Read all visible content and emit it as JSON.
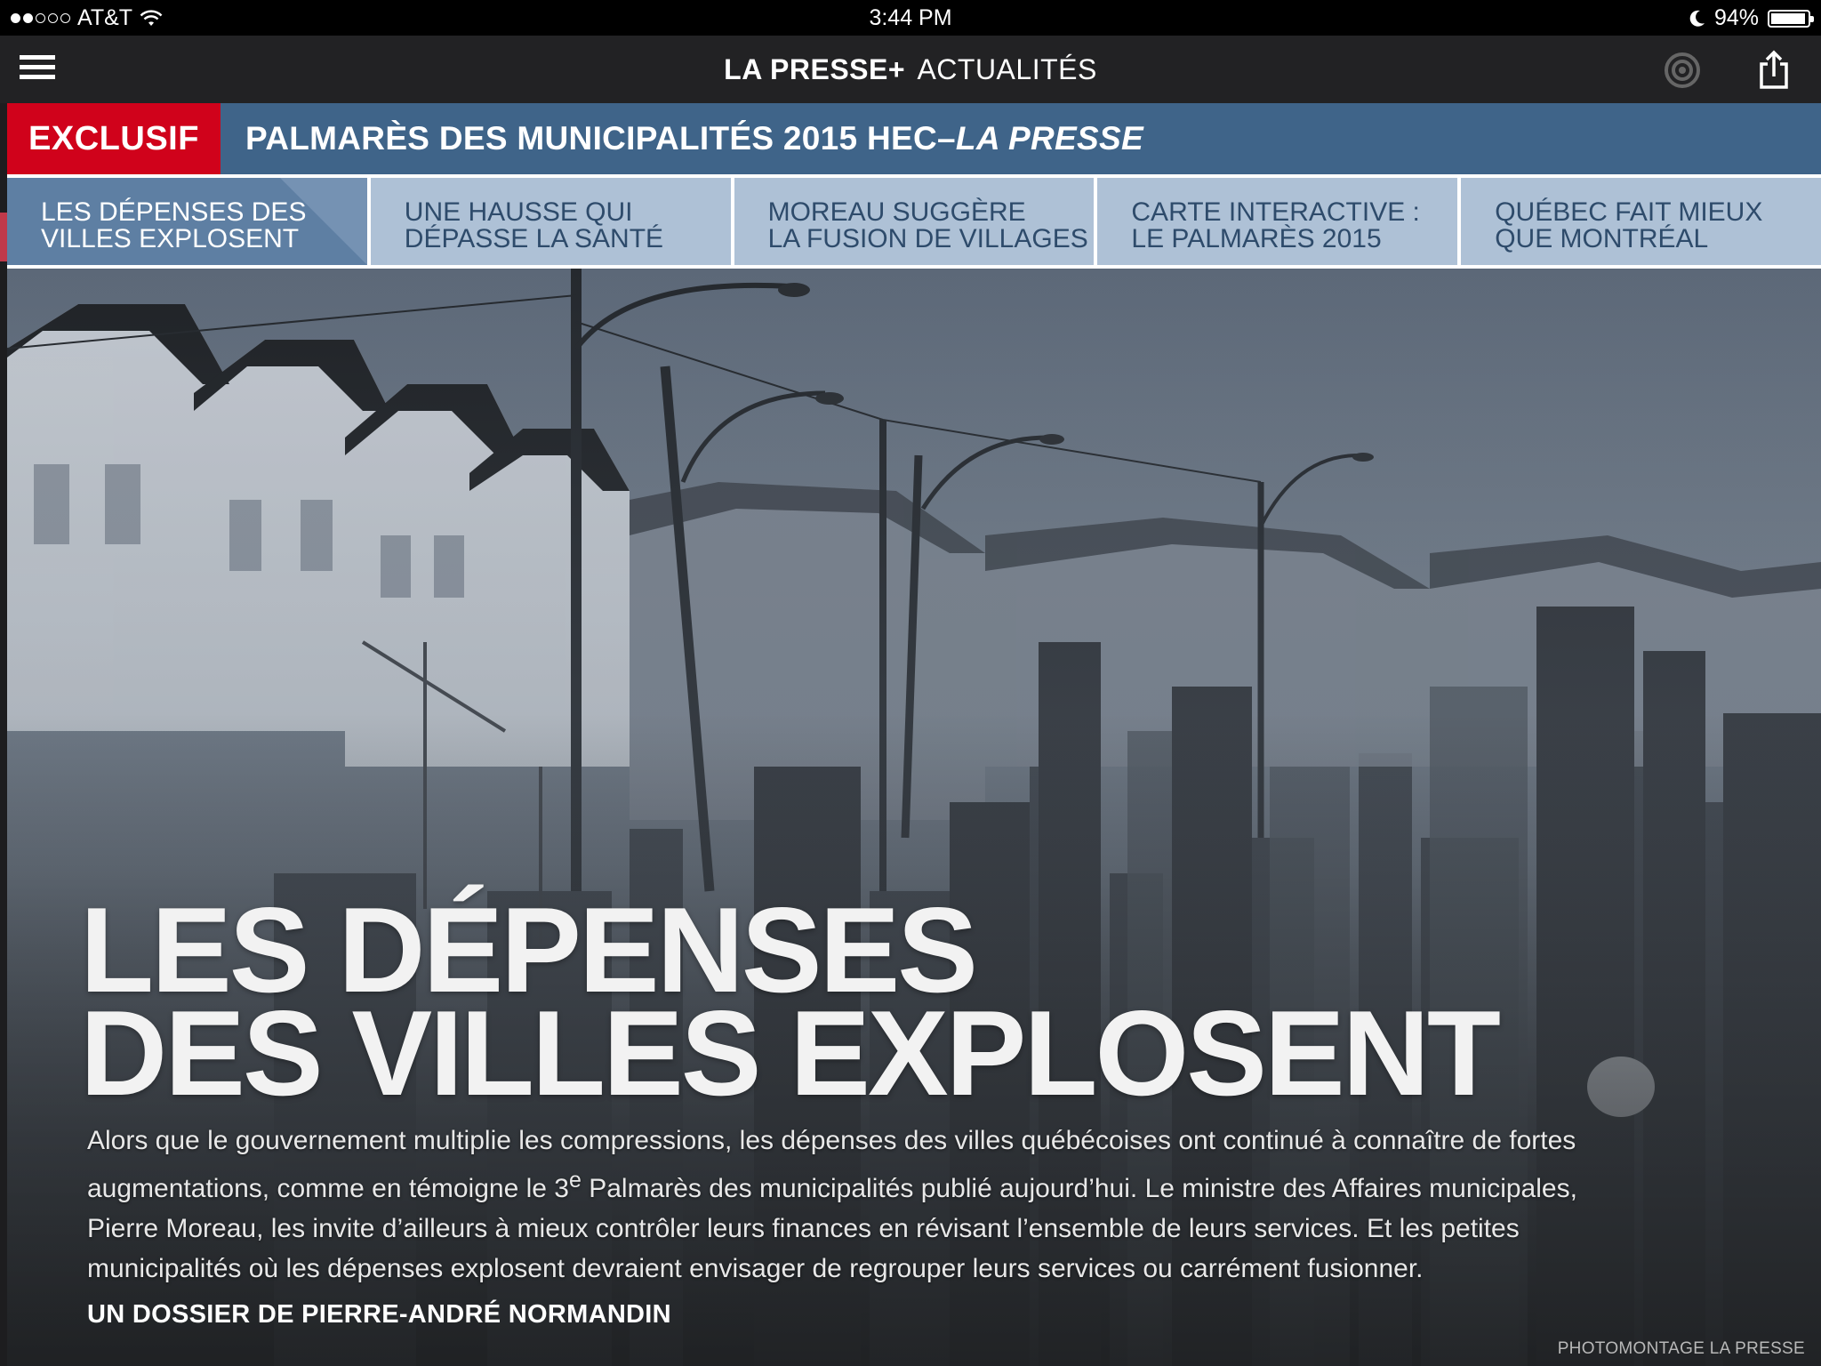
{
  "status_bar": {
    "carrier": "AT&T",
    "time": "3:44 PM",
    "battery": "94%",
    "battery_level": 0.94,
    "signal_bars_filled": 2,
    "signal_bars_total": 5
  },
  "app_bar": {
    "brand": "LA PRESSE+",
    "section": "ACTUALITÉS"
  },
  "banner": {
    "tag": "EXCLUSIF",
    "title_main": "PALMARÈS DES MUNICIPALITÉS 2015 HEC–",
    "title_italic": "LA PRESSE"
  },
  "tabs": [
    {
      "line1": "Les dépenses des",
      "line2": "villes explosent",
      "active": true
    },
    {
      "line1": "Une hausse qui",
      "line2": "dépasse la santé",
      "active": false
    },
    {
      "line1": "Moreau suggère",
      "line2": "la fusion de villages",
      "active": false
    },
    {
      "line1": "Carte interactive :",
      "line2": "le palmarès 2015",
      "active": false
    },
    {
      "line1": "Québec fait mieux",
      "line2": "que Montréal",
      "active": false
    }
  ],
  "article": {
    "headline_line1": "Les dépenses",
    "headline_line2": "des villes explosent",
    "dek_before_sup": "Alors que le gouvernement multiplie les compressions, les dépenses des villes québécoises ont continué à connaître de fortes augmentations, comme en témoigne le 3",
    "dek_sup": "e",
    "dek_after_sup": " Palmarès des municipalités publié aujourd’hui. Le ministre des Affaires municipales, Pierre Moreau, les invite d’ailleurs à mieux contrôler leurs finances en révisant l’ensemble de leurs services. Et les petites municipalités où les dépenses explosent devraient envisager de regrouper leurs services ou carrément fusionner.",
    "byline": "UN DOSSIER DE PIERRE-ANDRÉ NORMANDIN",
    "photo_credit": "PHOTOMONTAGE LA PRESSE"
  },
  "icons": {
    "menu": "hamburger-icon",
    "radio": "broadcast-icon",
    "share": "share-icon",
    "wifi": "wifi-icon",
    "moon": "moon-icon"
  },
  "colors": {
    "exclusif_red": "#d0021b",
    "banner_blue": "#3f6489",
    "tab_bg": "#aec1d6",
    "tab_active_bg": "#5e7fa3",
    "tab_text": "#2e4b6b"
  }
}
